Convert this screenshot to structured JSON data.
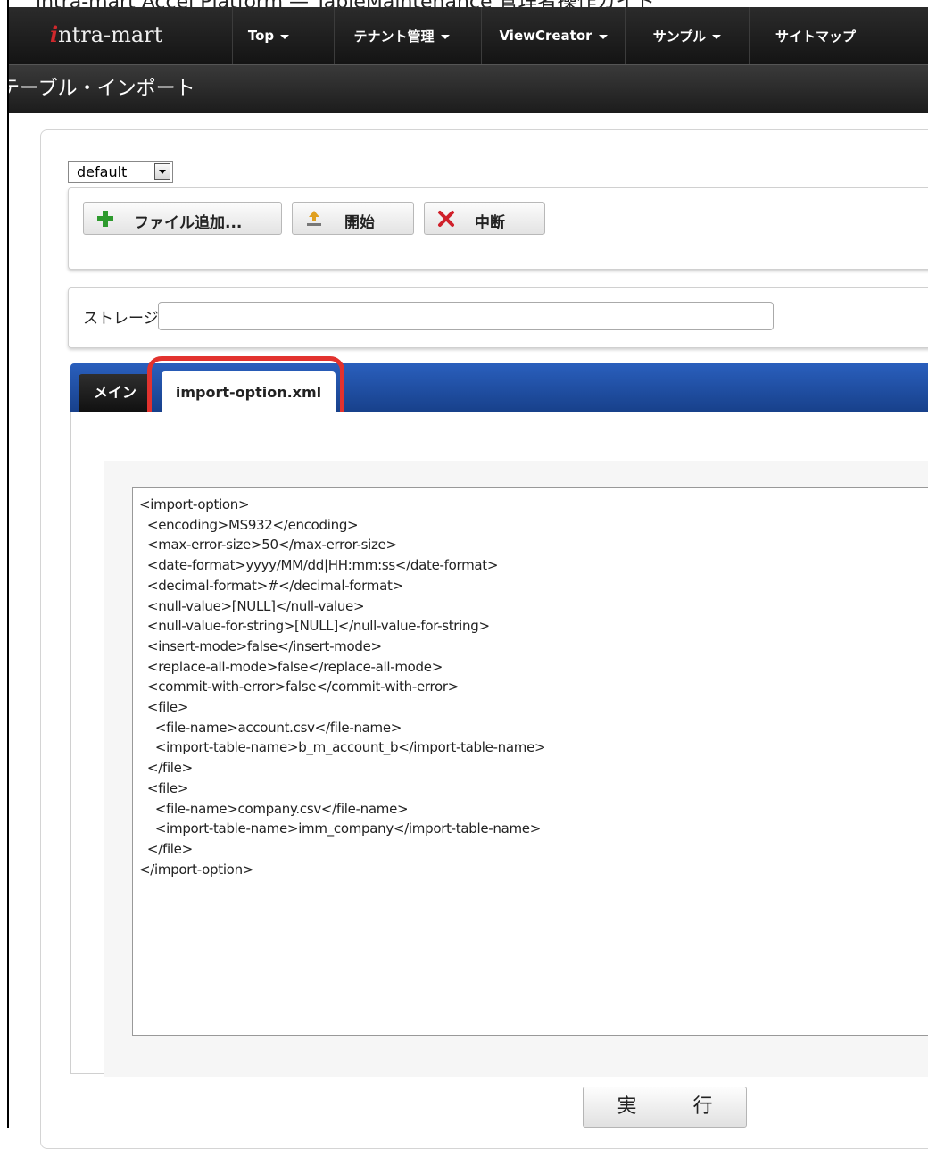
{
  "caption": "intra-mart Accel Platform — TableMaintenance 管理者操作ガイド",
  "navbar": {
    "logo": "intra-mart",
    "items": [
      {
        "label": "Top",
        "dropdown": true
      },
      {
        "label": "テナント管理",
        "dropdown": true
      },
      {
        "label": "ViewCreator",
        "dropdown": true
      },
      {
        "label": "サンプル",
        "dropdown": true
      },
      {
        "label": "サイトマップ",
        "dropdown": false
      }
    ]
  },
  "page": {
    "title": "テーブル・インポート"
  },
  "profile_select": {
    "value": "default"
  },
  "toolbar": {
    "add_file": "ファイル追加...",
    "start": "開始",
    "abort": "中断"
  },
  "storage": {
    "label": "ストレージ",
    "value": ""
  },
  "tabs": {
    "main": "メイン",
    "xml": "import-option.xml"
  },
  "xml_content": "<import-option>\n  <encoding>MS932</encoding>\n  <max-error-size>50</max-error-size>\n  <date-format>yyyy/MM/dd|HH:mm:ss</date-format>\n  <decimal-format>#</decimal-format>\n  <null-value>[NULL]</null-value>\n  <null-value-for-string>[NULL]</null-value-for-string>\n  <insert-mode>false</insert-mode>\n  <replace-all-mode>false</replace-all-mode>\n  <commit-with-error>false</commit-with-error>\n  <file>\n    <file-name>account.csv</file-name>\n    <import-table-name>b_m_account_b</import-table-name>\n  </file>\n  <file>\n    <file-name>company.csv</file-name>\n    <import-table-name>imm_company</import-table-name>\n  </file>\n</import-option>",
  "run_button": "実 行",
  "colors": {
    "navbar": "#1c1c1c",
    "tabbar": "#1d4a9a",
    "highlight": "#e2322e",
    "add_icon": "#2e9a2e",
    "abort_icon": "#d0202a"
  }
}
